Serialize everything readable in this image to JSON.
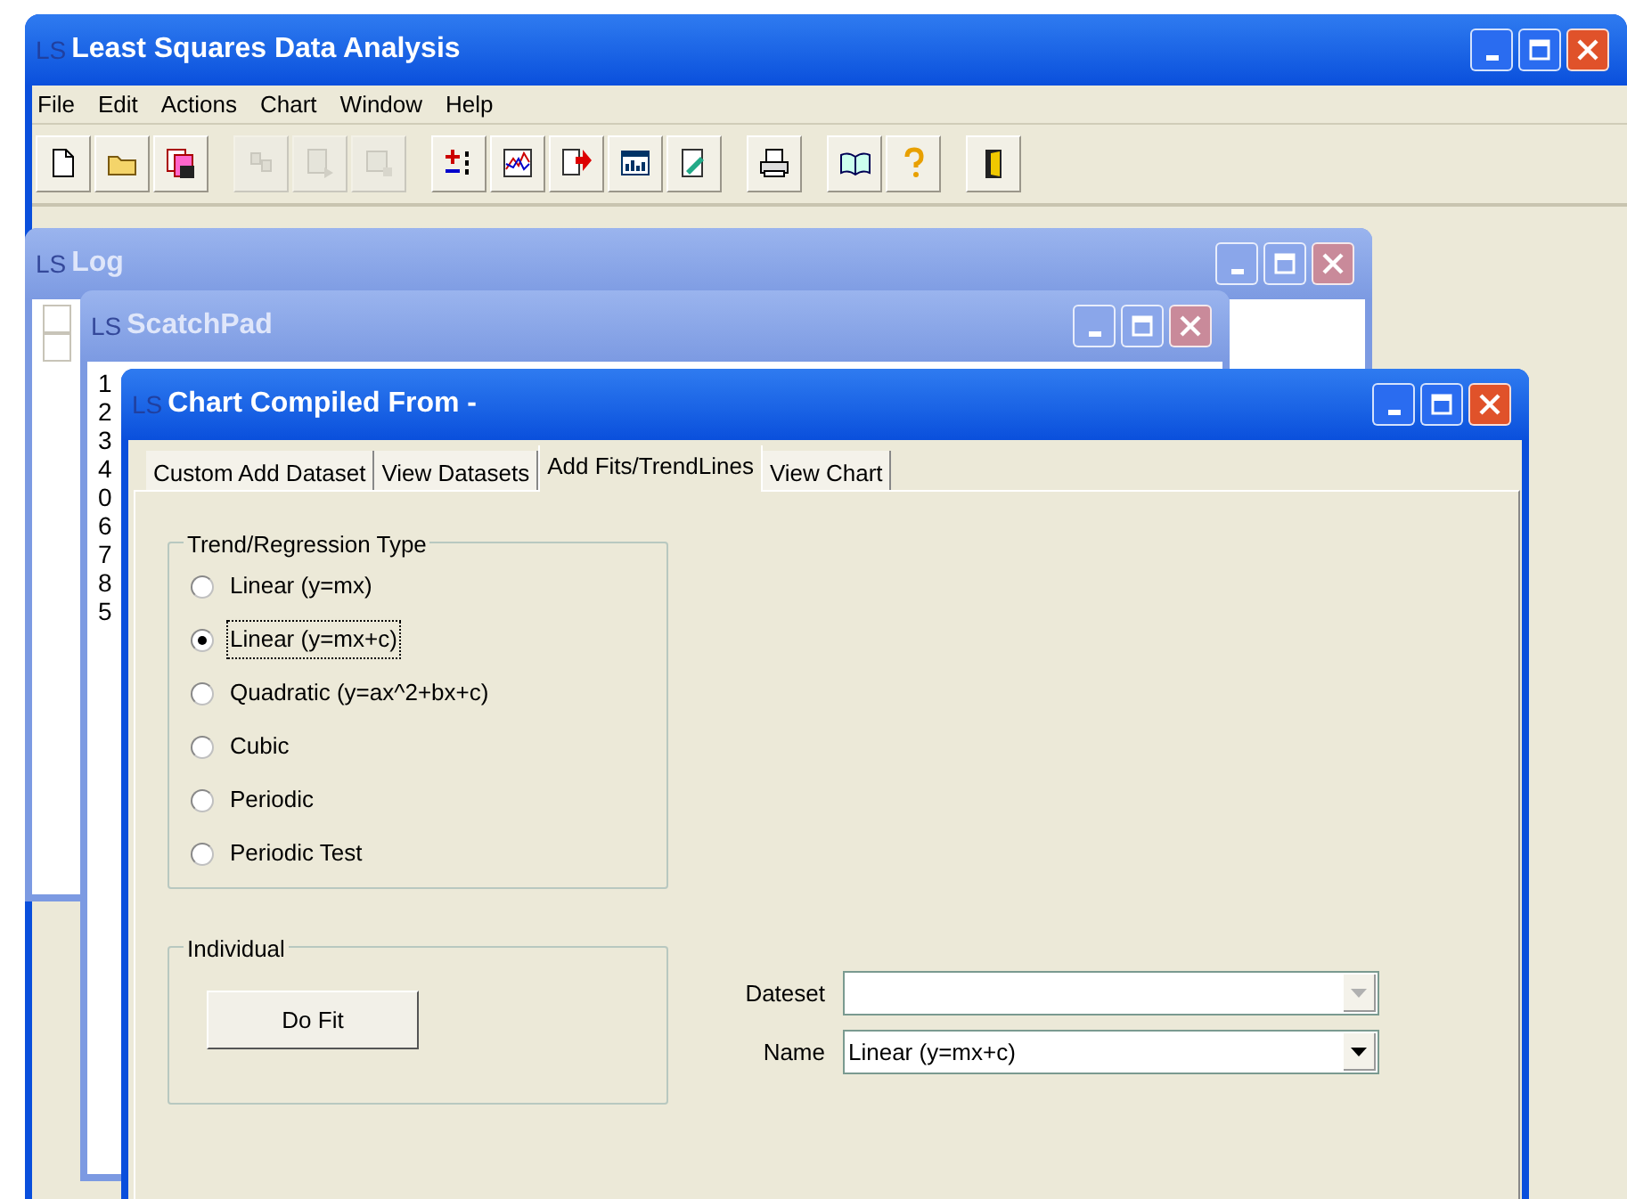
{
  "main_window": {
    "title": "Least Squares Data Analysis",
    "icon_text": "LS",
    "active": true
  },
  "menu": [
    "File",
    "Edit",
    "Actions",
    "Chart",
    "Window",
    "Help"
  ],
  "toolbar": [
    [
      {
        "disabled": false
      },
      {
        "disabled": false
      },
      {
        "disabled": false
      }
    ],
    [
      {
        "disabled": true
      },
      {
        "disabled": true
      },
      {
        "disabled": true
      }
    ],
    [
      {
        "disabled": false
      },
      {
        "disabled": false
      },
      {
        "disabled": false
      },
      {
        "disabled": false
      },
      {
        "disabled": false
      }
    ],
    [
      {
        "disabled": false
      }
    ],
    [
      {
        "disabled": false
      },
      {
        "disabled": false
      }
    ],
    [
      {
        "disabled": false
      }
    ]
  ],
  "log_window": {
    "title": "Log",
    "icon_text": "LS",
    "active": false,
    "rows": [
      {
        "checked": false
      },
      {
        "checked": false
      }
    ]
  },
  "scratchpad_window": {
    "title": "ScatchPad",
    "icon_text": "LS",
    "active": false,
    "lines": [
      "1",
      "2",
      "3",
      "4",
      "0",
      "6",
      "7",
      "8",
      "5"
    ]
  },
  "chart_window": {
    "title": "Chart Compiled From -",
    "icon_text": "LS",
    "active": true,
    "tabs": [
      {
        "label": "Custom Add Dataset",
        "selected": false
      },
      {
        "label": "View Datasets",
        "selected": false
      },
      {
        "label": "Add Fits/TrendLines",
        "selected": true
      },
      {
        "label": "View Chart",
        "selected": false
      }
    ],
    "regression_group": {
      "title": "Trend/Regression Type",
      "options": [
        {
          "label": "Linear (y=mx)",
          "selected": false
        },
        {
          "label": "Linear (y=mx+c)",
          "selected": true
        },
        {
          "label": "Quadratic (y=ax^2+bx+c)",
          "selected": false
        },
        {
          "label": "Cubic",
          "selected": false
        },
        {
          "label": "Periodic",
          "selected": false
        },
        {
          "label": "Periodic Test",
          "selected": false
        }
      ]
    },
    "individual_group": {
      "title": "Individual",
      "button": "Do Fit"
    },
    "fields": [
      {
        "label": "Dateset",
        "disabled": true
      },
      {
        "label": "Name",
        "value": "Linear (y=mx+c)",
        "disabled": false
      }
    ]
  }
}
